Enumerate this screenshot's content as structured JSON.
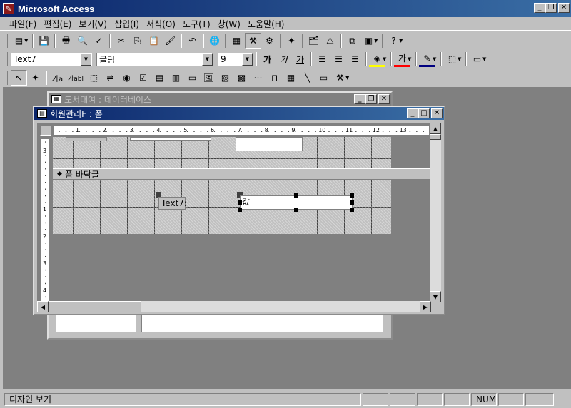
{
  "app": {
    "title": "Microsoft Access",
    "icon": "access-key-icon"
  },
  "menu": [
    "파일(F)",
    "편집(E)",
    "보기(V)",
    "삽입(I)",
    "서식(O)",
    "도구(T)",
    "창(W)",
    "도움말(H)"
  ],
  "format_toolbar": {
    "object_combo": "Text7",
    "font_combo": "굴림",
    "size_combo": "9",
    "bold": "가",
    "italic": "가",
    "underline": "가",
    "fore_color_glyph": "가"
  },
  "toolbox": {
    "label_tool": "가a",
    "text_tool": "가abl"
  },
  "windows": {
    "database": {
      "title": "도서대여 : 데이터베이스"
    },
    "form": {
      "title": "회원관리F : 폼",
      "section_header": "폼 바닥글",
      "controls": {
        "label_text": "Text7:",
        "textbox_text": "값"
      },
      "hruler_ticks": [
        "1",
        "2",
        "3",
        "4",
        "5",
        "6",
        "7",
        "8",
        "9",
        "10",
        "11",
        "12",
        "13"
      ],
      "vruler_ticks": [
        "3",
        "1",
        "2",
        "3",
        "4"
      ]
    }
  },
  "status": {
    "view": "디자인 보기",
    "num": "NUM"
  },
  "colors": {
    "title_active": "#0a246a",
    "title_inactive": "#808080",
    "font_color_underline": "#ff0000",
    "highlight_underline": "#ffff00"
  }
}
